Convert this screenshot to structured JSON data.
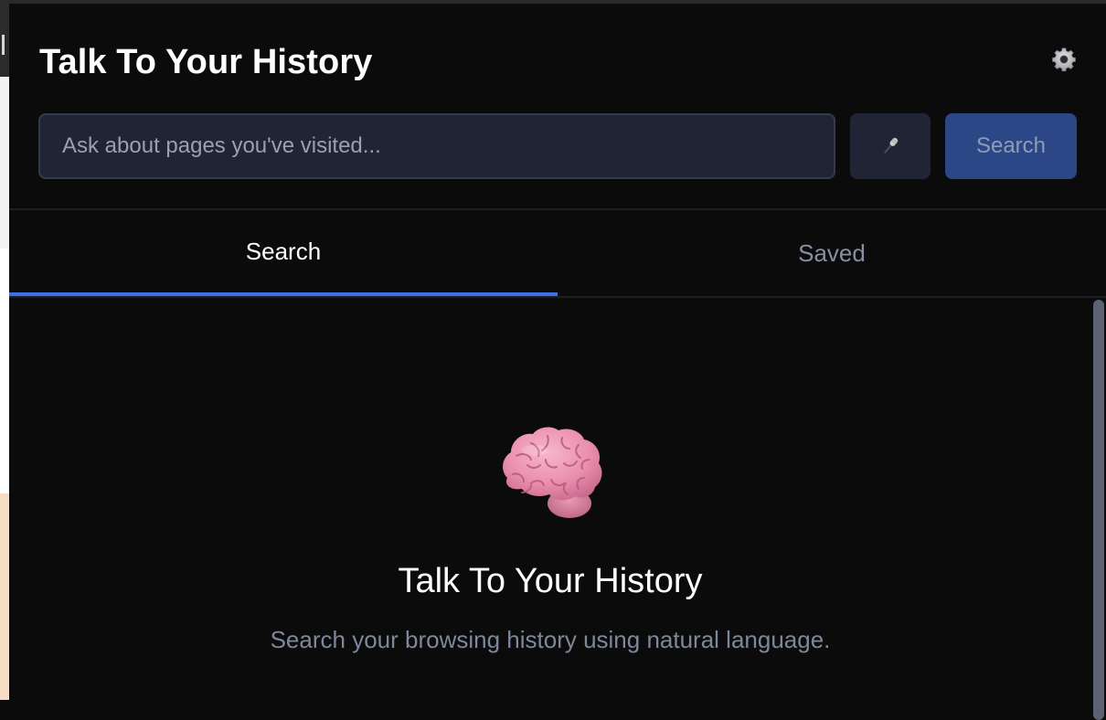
{
  "header": {
    "title": "Talk To Your History",
    "settings_icon": "gear-icon"
  },
  "search": {
    "placeholder": "Ask about pages you've visited...",
    "value": "",
    "mic_icon": "microphone-icon",
    "button_label": "Search"
  },
  "tabs": [
    {
      "label": "Search",
      "active": true
    },
    {
      "label": "Saved",
      "active": false
    }
  ],
  "empty_state": {
    "icon": "brain-icon",
    "title": "Talk To Your History",
    "subtitle": "Search your browsing history using natural language."
  },
  "colors": {
    "background": "#0b0b0c",
    "input_bg": "#1f2534",
    "accent": "#3f6ee8",
    "search_button_bg": "#2c4786",
    "muted_text": "#7e879b"
  }
}
